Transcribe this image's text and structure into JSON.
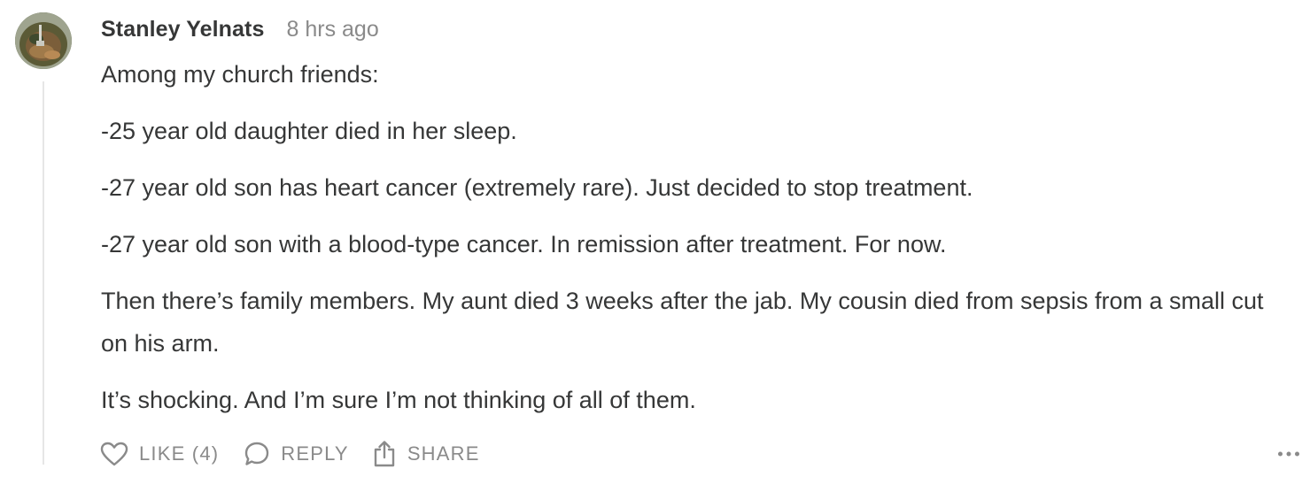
{
  "comment": {
    "author": "Stanley Yelnats",
    "timestamp": "8 hrs ago",
    "paragraphs": [
      "Among my church friends:",
      "-25 year old daughter died in her sleep.",
      "-27 year old son has heart cancer (extremely rare). Just decided to stop treatment.",
      "-27 year old son with a blood-type cancer. In remission after treatment. For now.",
      "Then there’s family members. My aunt died 3 weeks after the jab. My cousin died from sepsis from a small cut on his arm.",
      "It’s shocking. And I’m sure I’m not thinking of all of them."
    ]
  },
  "actions": {
    "like_label": "LIKE (4)",
    "reply_label": "REPLY",
    "share_label": "SHARE",
    "like_icon": "heart-icon",
    "reply_icon": "speech-bubble-icon",
    "share_icon": "share-icon",
    "more_icon": "more-icon"
  },
  "colors": {
    "text": "#363737",
    "muted": "#8a8a8a",
    "thread_line": "#e6e6e6"
  }
}
